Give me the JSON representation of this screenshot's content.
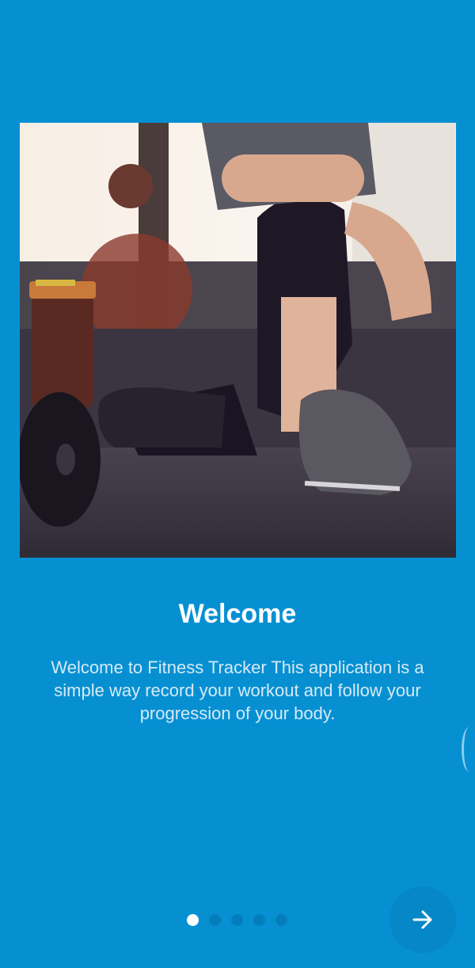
{
  "onboarding": {
    "title": "Welcome",
    "description": "Welcome to Fitness Tracker This application is a simple way record your workout and follow your progression of your body.",
    "page_count": 5,
    "current_page": 1,
    "next_icon": "arrow-right-icon"
  },
  "colors": {
    "background": "#0690d2",
    "title_text": "#ffffff",
    "description_text": "#d6eaf6",
    "active_dot": "#ffffff"
  }
}
